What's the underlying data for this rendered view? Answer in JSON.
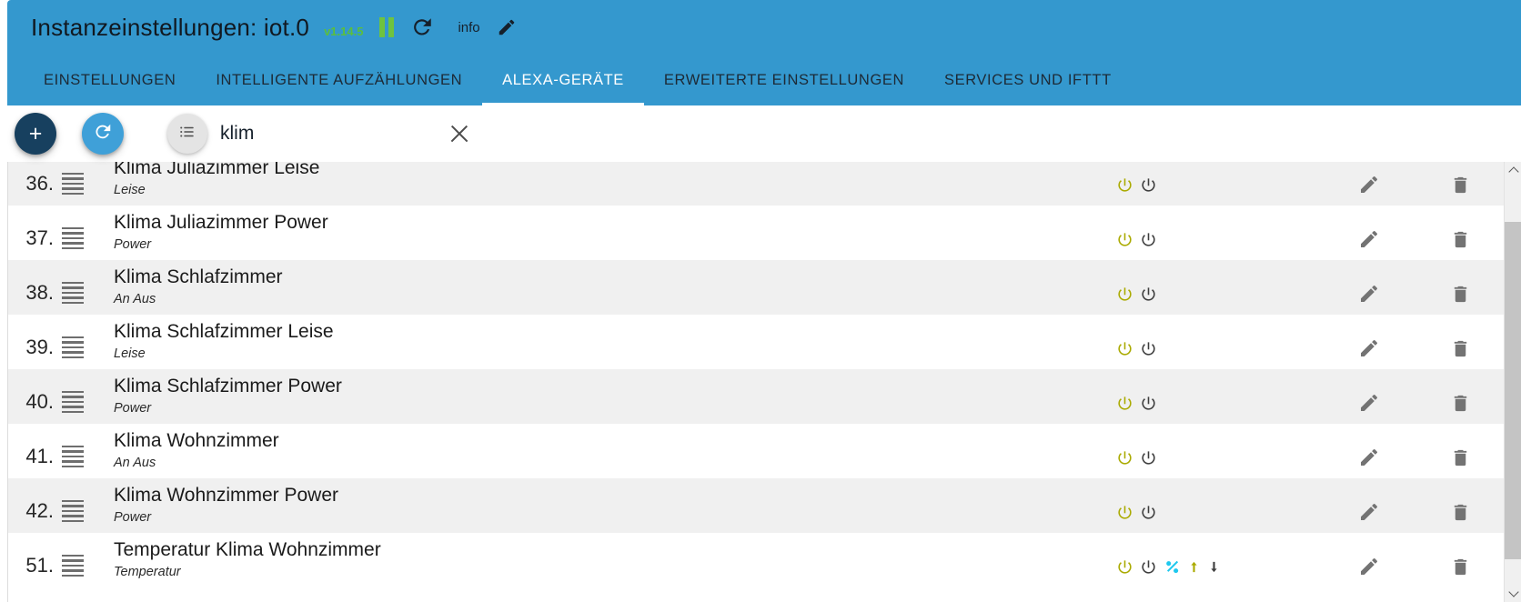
{
  "header": {
    "title": "Instanzeinstellungen: iot.0",
    "version": "v1.14.5",
    "info_label": "info",
    "pause_icon": "pause-icon",
    "refresh_icon": "refresh-icon",
    "edit_icon": "pencil-icon",
    "background_color": "#3498ce",
    "version_color": "#5bbf3c",
    "pause_color": "#6ec340"
  },
  "tabs": [
    {
      "label": "EINSTELLUNGEN",
      "active": false
    },
    {
      "label": "INTELLIGENTE AUFZÄHLUNGEN",
      "active": false
    },
    {
      "label": "ALEXA-GERÄTE",
      "active": true
    },
    {
      "label": "ERWEITERTE EINSTELLUNGEN",
      "active": false
    },
    {
      "label": "SERVICES UND IFTTT",
      "active": false
    }
  ],
  "toolbar": {
    "add_label": "+",
    "add_icon": "plus-icon",
    "add_color": "#17405f",
    "refresh_icon": "refresh-icon",
    "refresh_color": "#3fa0d8",
    "list_icon": "list-icon",
    "list_color": "#e4e4e4",
    "search_value": "klim",
    "search_placeholder": "",
    "clear_icon": "close-icon"
  },
  "list": {
    "columns": [
      "index",
      "drag",
      "name",
      "role",
      "states",
      "actions"
    ],
    "edit_icon": "pencil-icon",
    "delete_icon": "trash-icon",
    "state_colors": {
      "power_on": "#aaaa00",
      "power_off": "#3d3d3d",
      "percent": "#1ec8ee",
      "up": "#aaaa00",
      "down": "#3d3d3d"
    },
    "rows": [
      {
        "index": "36.",
        "name": "Klima Juliazimmer Leise",
        "role": "Leise",
        "states": [
          "power-on-icon",
          "power-off-icon"
        ]
      },
      {
        "index": "37.",
        "name": "Klima Juliazimmer Power",
        "role": "Power",
        "states": [
          "power-on-icon",
          "power-off-icon"
        ]
      },
      {
        "index": "38.",
        "name": "Klima Schlafzimmer",
        "role": "An Aus",
        "states": [
          "power-on-icon",
          "power-off-icon"
        ]
      },
      {
        "index": "39.",
        "name": "Klima Schlafzimmer Leise",
        "role": "Leise",
        "states": [
          "power-on-icon",
          "power-off-icon"
        ]
      },
      {
        "index": "40.",
        "name": "Klima Schlafzimmer Power",
        "role": "Power",
        "states": [
          "power-on-icon",
          "power-off-icon"
        ]
      },
      {
        "index": "41.",
        "name": "Klima Wohnzimmer",
        "role": "An Aus",
        "states": [
          "power-on-icon",
          "power-off-icon"
        ]
      },
      {
        "index": "42.",
        "name": "Klima Wohnzimmer Power",
        "role": "Power",
        "states": [
          "power-on-icon",
          "power-off-icon"
        ]
      },
      {
        "index": "51.",
        "name": "Temperatur Klima Wohnzimmer",
        "role": "Temperatur",
        "states": [
          "power-on-icon",
          "power-off-icon",
          "percent-icon",
          "arrow-up-icon",
          "arrow-down-icon"
        ]
      }
    ]
  },
  "scrollbar": {
    "up_icon": "chevron-up-icon",
    "down_icon": "chevron-down-icon",
    "thumb_color": "#c4c4c4"
  }
}
